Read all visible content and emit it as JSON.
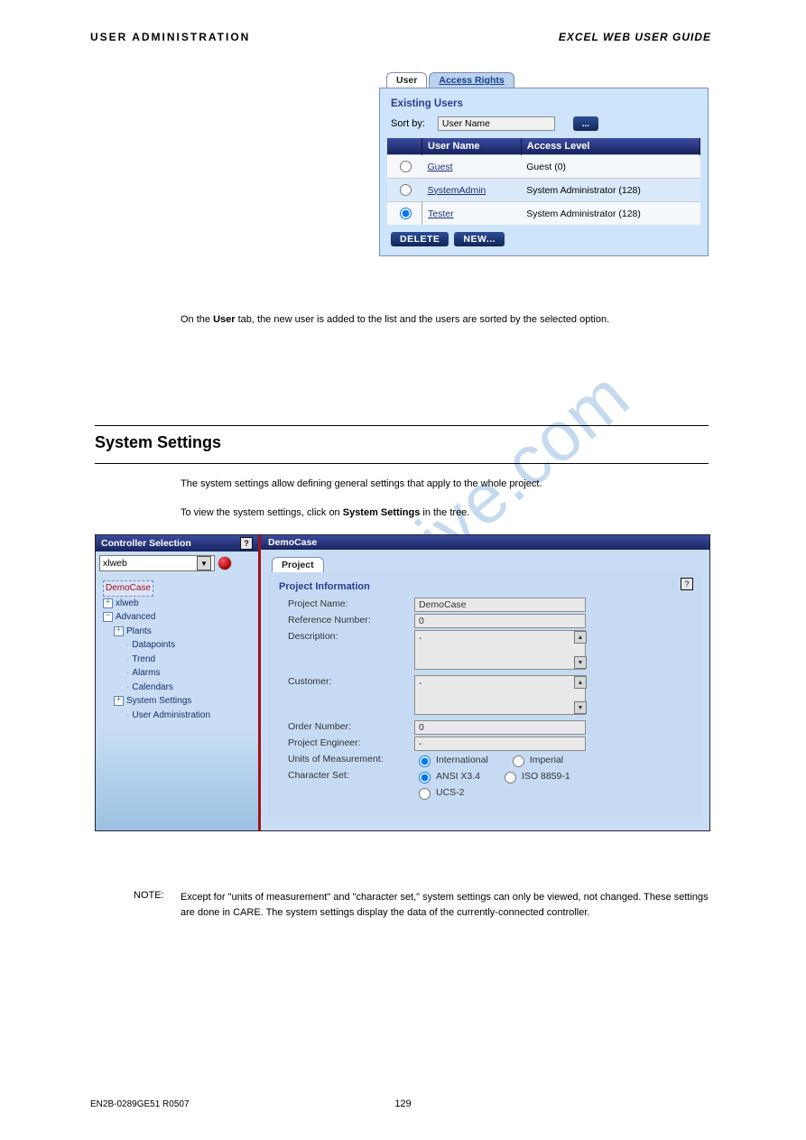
{
  "header": {
    "left": "USER ADMINISTRATION",
    "right": "EXCEL WEB USER GUIDE"
  },
  "footer": {
    "page": "129",
    "left": "EN2B-0289GE51 R0507",
    "right": ""
  },
  "users_panel": {
    "tabs": {
      "active": "User",
      "inactive": "Access Rights"
    },
    "title": "Existing Users",
    "sort_label": "Sort by:",
    "sort_value": "User Name",
    "ellipsis": "...",
    "cols": {
      "c1": "User Name",
      "c2": "Access Level"
    },
    "rows": [
      {
        "selected": false,
        "name": "Guest",
        "level": "Guest (0)"
      },
      {
        "selected": false,
        "name": "SystemAdmin",
        "level": "System Administrator (128)"
      },
      {
        "selected": true,
        "name": "Tester",
        "level": "System Administrator (128)"
      }
    ],
    "buttons": {
      "delete": "DELETE",
      "new": "NEW..."
    }
  },
  "body": {
    "para1_a": "On the ",
    "para1_b": "User",
    "para1_c": " tab, the new user is added to the list and the users are sorted by the selected option."
  },
  "section": {
    "title": "System Settings"
  },
  "intro": {
    "line1": "The system settings allow defining general settings that apply to the whole project.",
    "line2_a": "To view the system settings, click on ",
    "line2_b": "System Settings",
    "line2_c": " in the tree."
  },
  "app": {
    "left_header": "Controller Selection",
    "device": "xlweb",
    "tree": {
      "root": "DemoCase",
      "n1": "xlweb",
      "n2": "Advanced",
      "n3": "Plants",
      "leaf1": "Datapoints",
      "leaf2": "Trend",
      "leaf3": "Alarms",
      "leaf4": "Calendars",
      "n4": "System Settings",
      "leaf5": "User Administration"
    },
    "main_title": "DemoCase",
    "proj_tab": "Project",
    "proj_title": "Project Information",
    "fields": {
      "name_l": "Project Name:",
      "name_v": "DemoCase",
      "ref_l": "Reference Number:",
      "ref_v": "0",
      "desc_l": "Description:",
      "desc_v": "-",
      "cust_l": "Customer:",
      "cust_v": "-",
      "order_l": "Order Number:",
      "order_v": "0",
      "eng_l": "Project Engineer:",
      "eng_v": "-",
      "unit_l": "Units of Measurement:",
      "unit_intl": "International",
      "unit_imp": "Imperial",
      "char_l": "Character Set:",
      "char_ansi": "ANSI X3.4",
      "char_iso": "ISO 8859-1",
      "char_ucs": "UCS-2"
    }
  },
  "note": {
    "label": "NOTE:",
    "text": "Except for \"units of measurement\" and \"character set,\" system settings can only be viewed, not changed. These settings are done in CARE. The system settings display the data of the currently-connected controller."
  },
  "watermark": "manualshive.com"
}
